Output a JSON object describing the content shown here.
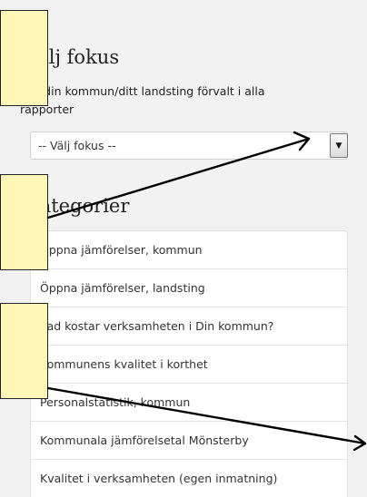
{
  "focus": {
    "title": "Välj fokus",
    "description": "Välj din kommun/ditt landsting förvalt i alla rapporter",
    "select_value": "-- Välj fokus --",
    "dropdown_icon": "triangle-down"
  },
  "categories": {
    "title": "Kategorier",
    "items": [
      "Öppna jämförelser, kommun",
      "Öppna jämförelser, landsting",
      "Vad kostar verksamheten i Din kommun?",
      "Kommunens kvalitet i korthet",
      "Personalstatistik, kommun",
      "Kommunala jämförelsetal Mönsterby",
      "Kvalitet i verksamheten (egen inmatning)"
    ]
  },
  "annotation_colors": {
    "callout_fill": "#fdf6b6",
    "callout_border": "#222222",
    "arrow": "#000000"
  }
}
